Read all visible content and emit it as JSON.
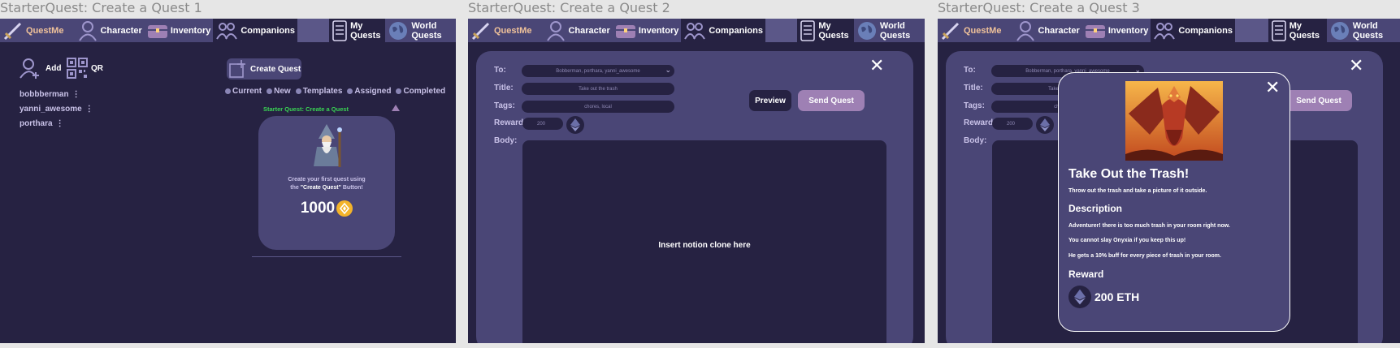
{
  "frames": [
    {
      "label": "StarterQuest: Create a Quest 1"
    },
    {
      "label": "StarterQuest: Create a Quest 2"
    },
    {
      "label": "StarterQuest: Create a Quest 3"
    }
  ],
  "nav": {
    "brand": "QuestMe",
    "character": "Character",
    "inventory": "Inventory",
    "companions": "Companions",
    "my_quests": "My Quests",
    "world_quests": "World Quests"
  },
  "screen1": {
    "add_label": "Add",
    "qr_label": "QR",
    "create_quest": "Create Quest",
    "companions": [
      "bobbberman",
      "yanni_awesome",
      "porthara"
    ],
    "filters": [
      "Current",
      "New",
      "Templates",
      "Assigned",
      "Completed"
    ],
    "quest_title": "Starter Quest: Create a Quest",
    "quest_text_1": "Create your first quest using",
    "quest_text_2a": "the ",
    "quest_text_2b": "\"Create Quest\"",
    "quest_text_2c": " Button!",
    "reward_value": "1000"
  },
  "form": {
    "to_label": "To:",
    "to_value": "Bobberman, porthara, yanni_awesome",
    "title_label": "Title:",
    "title_value": "Take out the trash",
    "tags_label": "Tags:",
    "tags_value": "chores, local",
    "reward_label": "Reward:",
    "reward_value": "200",
    "body_label": "Body:",
    "body_placeholder": "Insert notion clone here",
    "preview_btn": "Preview",
    "send_btn": "Send Quest",
    "close": "✕"
  },
  "preview": {
    "title": "Take Out the Trash!",
    "subtitle": "Throw out the trash and take a picture of it outside.",
    "description_heading": "Description",
    "desc_1": "Adventurer! there is too much trash in your room right now.",
    "desc_2": "You cannot slay Onyxia if you keep this up!",
    "desc_3": "He gets a 10% buff for every piece of trash in your room.",
    "reward_heading": "Reward",
    "reward_value": "200 ETH",
    "close": "✕"
  },
  "colors": {
    "background": "#262242",
    "panel": "#4a4676",
    "accent": "#9e80b4",
    "brand": "#f0c29a",
    "coin": "#f3b32a",
    "starter_green": "#39d353"
  }
}
